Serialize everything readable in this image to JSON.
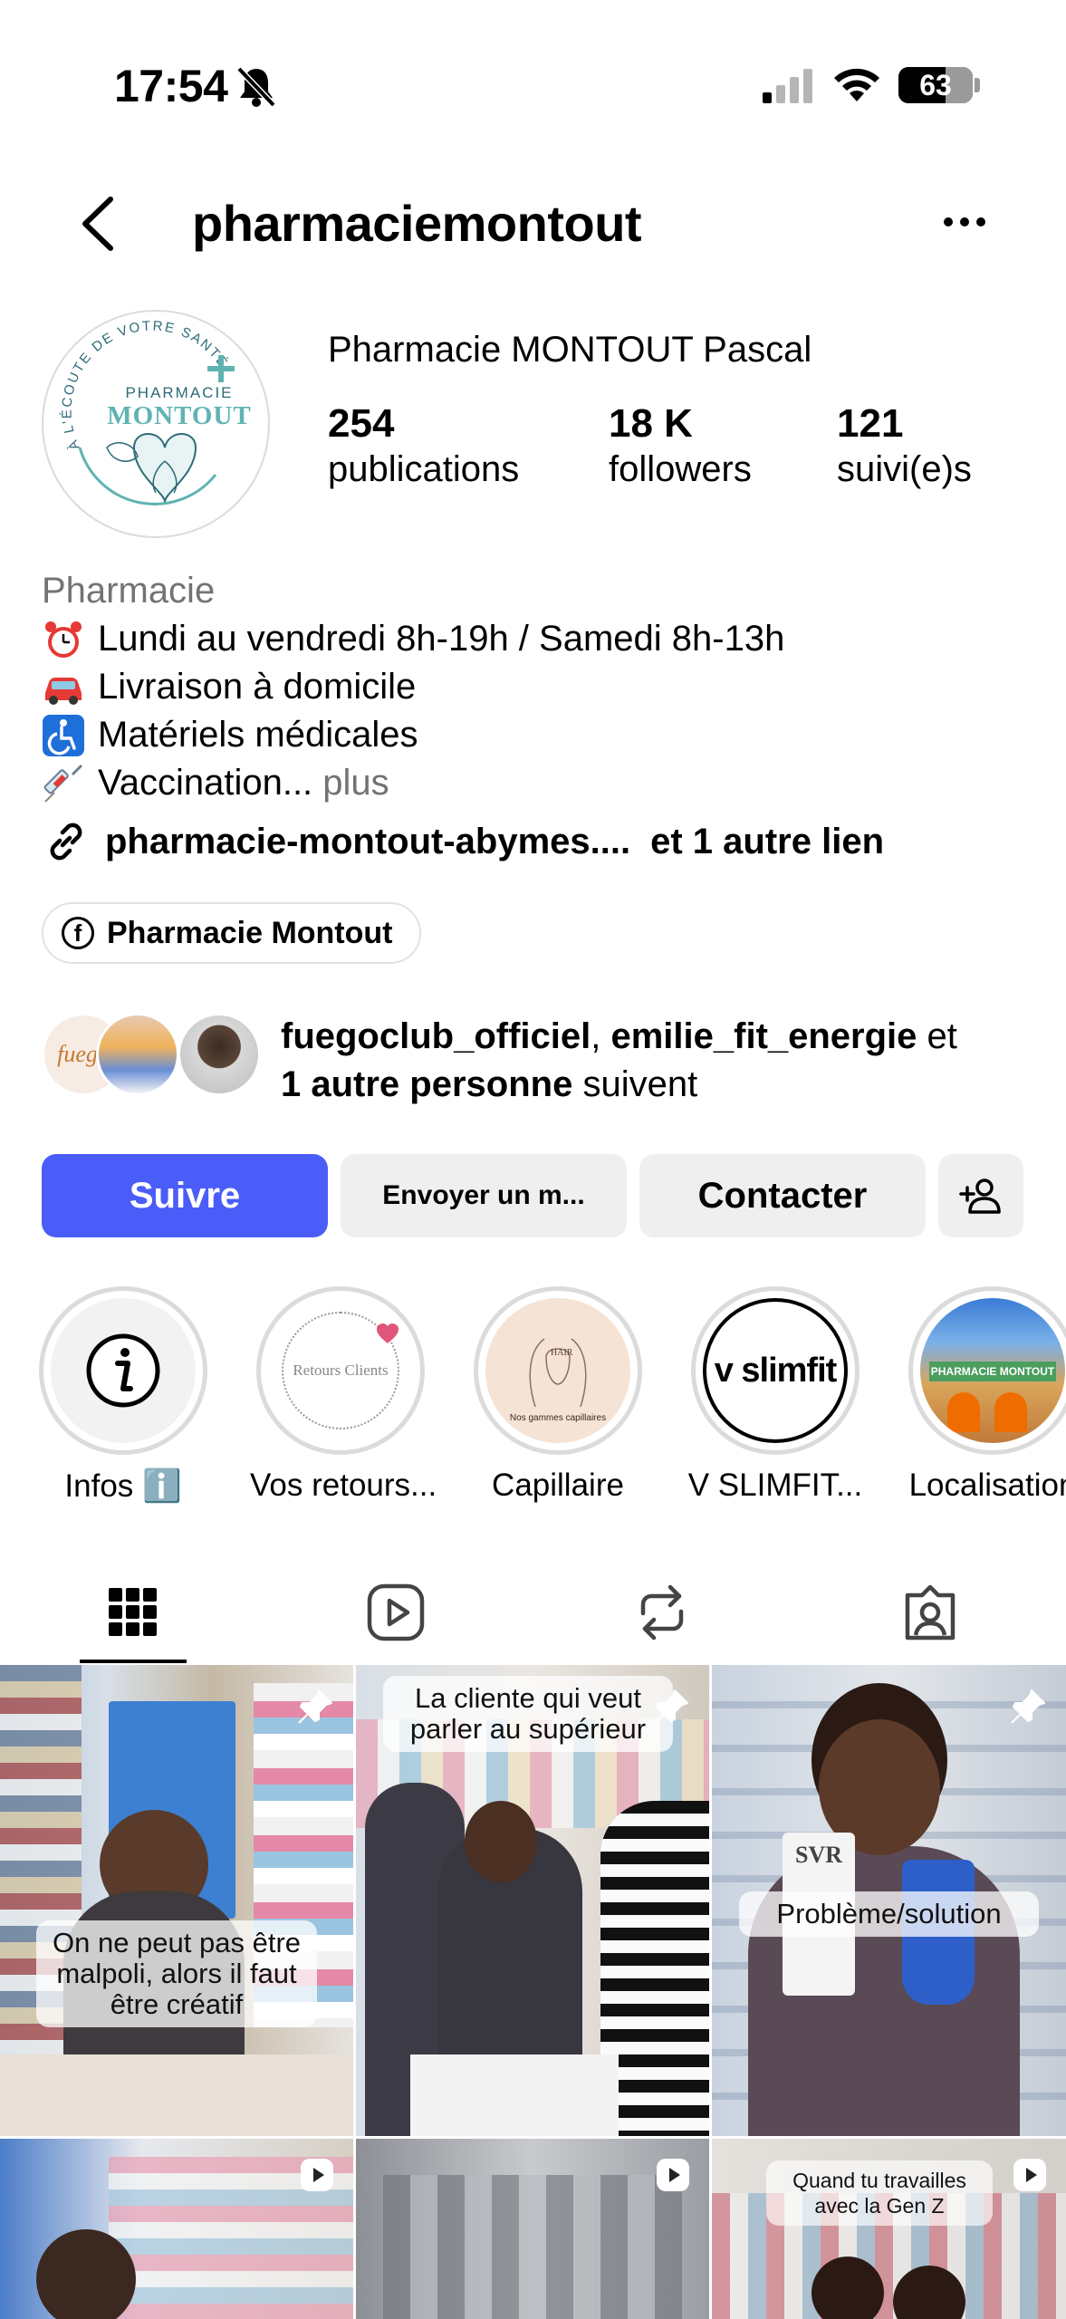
{
  "status_bar": {
    "time": "17:54",
    "battery_level": "63",
    "battery_fraction": 0.63
  },
  "header": {
    "username": "pharmaciemontout"
  },
  "profile": {
    "display_name": "Pharmacie MONTOUT Pascal",
    "avatar_text_top": "À L'ÉCOUTE DE VOTRE SANTÉ",
    "avatar_text_small": "PHARMACIE",
    "avatar_text_big": "MONTOUT",
    "stats": [
      {
        "value": "254",
        "label": "publications"
      },
      {
        "value": "18 K",
        "label": "followers"
      },
      {
        "value": "121",
        "label": "suivi(e)s"
      }
    ]
  },
  "bio": {
    "category": "Pharmacie",
    "lines": [
      {
        "icon": "alarm-clock-icon",
        "text": "Lundi au vendredi 8h-19h / Samedi 8h-13h"
      },
      {
        "icon": "car-icon",
        "text": "Livraison à domicile"
      },
      {
        "icon": "wheelchair-icon",
        "text": "Matériels médicales"
      },
      {
        "icon": "syringe-icon",
        "text": "Vaccination..."
      }
    ],
    "more_label": "plus",
    "link_text": "pharmacie-montout-abymes....",
    "link_extra": "et 1 autre lien",
    "facebook_chip": "Pharmacie Montout"
  },
  "followed_by": {
    "user1": "fuegoclub_officiel",
    "separator": ", ",
    "user2": "emilie_fit_energie",
    "and": " et",
    "others": "1 autre personne",
    "suffix": " suivent",
    "avatar1_text": "fuego"
  },
  "actions": {
    "follow": "Suivre",
    "message": "Envoyer un m...",
    "contact": "Contacter"
  },
  "highlights": [
    {
      "label": "Infos ℹ️",
      "icon": "info-icon"
    },
    {
      "label": "Vos retours...",
      "inner_text": "Retours Clients"
    },
    {
      "label": "Capillaire",
      "inner_text": "HAIR",
      "inner_sub": "Nos gammes capillaires"
    },
    {
      "label": "V SLIMFIT...",
      "inner_text": "v slimfit"
    },
    {
      "label": "Localisation",
      "inner_text": "PHARMACIE MONTOUT"
    }
  ],
  "tabs": [
    "grid-icon",
    "reels-icon",
    "reposts-icon",
    "tagged-icon"
  ],
  "posts": [
    {
      "caption": "On ne peut pas être malpoli, alors il faut être créatif",
      "pinned": true
    },
    {
      "caption": "La cliente qui veut parler au supérieur",
      "pinned": true
    },
    {
      "caption": "Problème/solution",
      "pinned": true,
      "product_text": "SVR"
    },
    {
      "caption": "",
      "video": true
    },
    {
      "caption": "",
      "video": true
    },
    {
      "caption": "Quand tu travailles avec la Gen Z",
      "video": true
    }
  ],
  "colors": {
    "follow_button": "#4a5df9",
    "secondary_button": "#efefef",
    "muted_text": "#737373",
    "brand_teal": "#5fb3b3"
  }
}
